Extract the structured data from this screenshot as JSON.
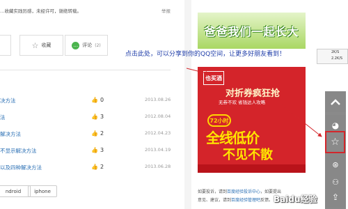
{
  "top_text": {
    "desc": "…收藏实践历感，未经许可，谢绝转载。",
    "report": "举报"
  },
  "actions": {
    "favorite": "收藏",
    "comment": "评论",
    "comment_count": "(2)"
  },
  "list": [
    {
      "title": "决方法",
      "num": "0",
      "date": "2013.08.26"
    },
    {
      "title": "法",
      "num": "3",
      "date": "2012.08.04"
    },
    {
      "title": "解决方法",
      "num": "2",
      "date": "2012.04.23"
    },
    {
      "title": "不显示解决方法",
      "num": "3",
      "date": "2013.04.19"
    },
    {
      "title": "以及四种解决方法",
      "num": "2",
      "date": "2013.06.28"
    }
  ],
  "tags": [
    "ndroid",
    "iphone"
  ],
  "ad_top": {
    "text": "爸爸我们一起长大"
  },
  "hint": "点击此处，可以分享到你的QQ空间，让更多好朋友看到！",
  "ad_big": {
    "logo": "也买酒",
    "title": "对折券疯狂抢",
    "sub": "无券不欢 省钱达人攻略",
    "badge": "72小时",
    "main1": "全线低价",
    "main2": "不见不散"
  },
  "footer": {
    "line1_a": "如要投诉，请到",
    "line1_link": "百度经验投诉中心",
    "line1_b": "，如要提出",
    "line2_a": "意见、建议，请到",
    "line2_link": "百度经验管理吧",
    "line2_b": "反馈。"
  },
  "qq_notice": {
    "line1": "2K/S",
    "line2": "2.2K/S"
  },
  "watermark": "Baidu经验",
  "colors": {
    "link": "#2a6fb4",
    "hint": "#1e3ca8",
    "ad_red": "#d4242a",
    "arrow": "#d3262b"
  }
}
